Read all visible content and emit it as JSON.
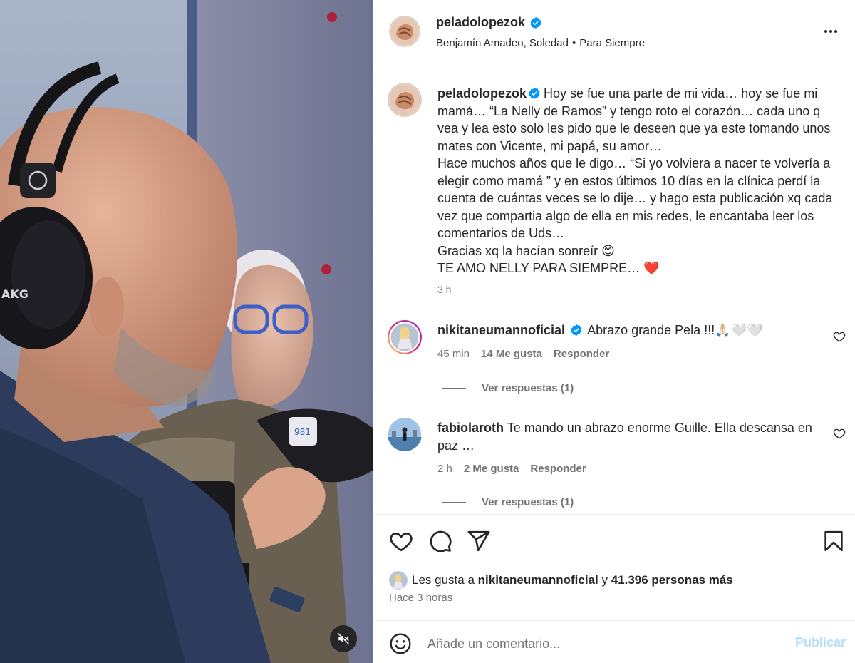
{
  "post": {
    "username": "peladolopezok",
    "verified": true,
    "music": {
      "artists": "Benjamín Amadeo, Soledad",
      "song": "Para Siempre"
    }
  },
  "caption": {
    "username": "peladolopezok",
    "lines": [
      "Hoy se fue una parte de mi vida… hoy se fue mi mamá… “La Nelly de Ramos” y tengo roto el corazón… cada uno q vea y lea esto solo les pido que le deseen que ya este tomando unos mates con Vicente, mi papá, su amor…",
      "Hace muchos años que le digo… “Si yo volviera a nacer te volvería a elegir como mamá ” y en estos últimos 10 días en la clínica perdí la cuenta de cuántas veces se lo dije… y hago esta publicación xq cada vez que compartia algo de ella en mis redes, le encantaba leer los comentarios de Uds…",
      "Gracias xq la hacían sonreír 😊",
      "TE AMO NELLY PARA SIEMPRE… ❤️"
    ],
    "time": "3 h"
  },
  "comments": [
    {
      "username": "nikitaneumannoficial",
      "verified": true,
      "text": "Abrazo grande Pela !!!🙏🏻🤍🤍",
      "time": "45 min",
      "likes": "14 Me gusta",
      "reply": "Responder",
      "view_replies": "Ver respuestas (1)"
    },
    {
      "username": "fabiolaroth",
      "verified": false,
      "text": "Te mando un abrazo enorme Guille. Ella descansa en paz …",
      "time": "2 h",
      "likes": "2 Me gusta",
      "reply": "Responder",
      "view_replies": "Ver respuestas (1)"
    }
  ],
  "likes_line": {
    "prefix": "Les gusta a",
    "user": "nikitaneumannoficial",
    "connector": "y",
    "others": "41.396 personas más"
  },
  "posted_ago": "Hace 3 horas",
  "add_comment": {
    "placeholder": "Añade un comentario...",
    "publish": "Publicar"
  },
  "icons": {
    "header": [
      "more-icon"
    ],
    "actions": [
      "heart-icon",
      "comment-icon",
      "share-icon",
      "bookmark-icon"
    ],
    "media": [
      "mute-icon"
    ]
  },
  "colors": {
    "verified": "#0095f6",
    "secondary_text": "#737373",
    "publish_disabled": "#b2dffc",
    "heart_red": "#ed4956"
  }
}
